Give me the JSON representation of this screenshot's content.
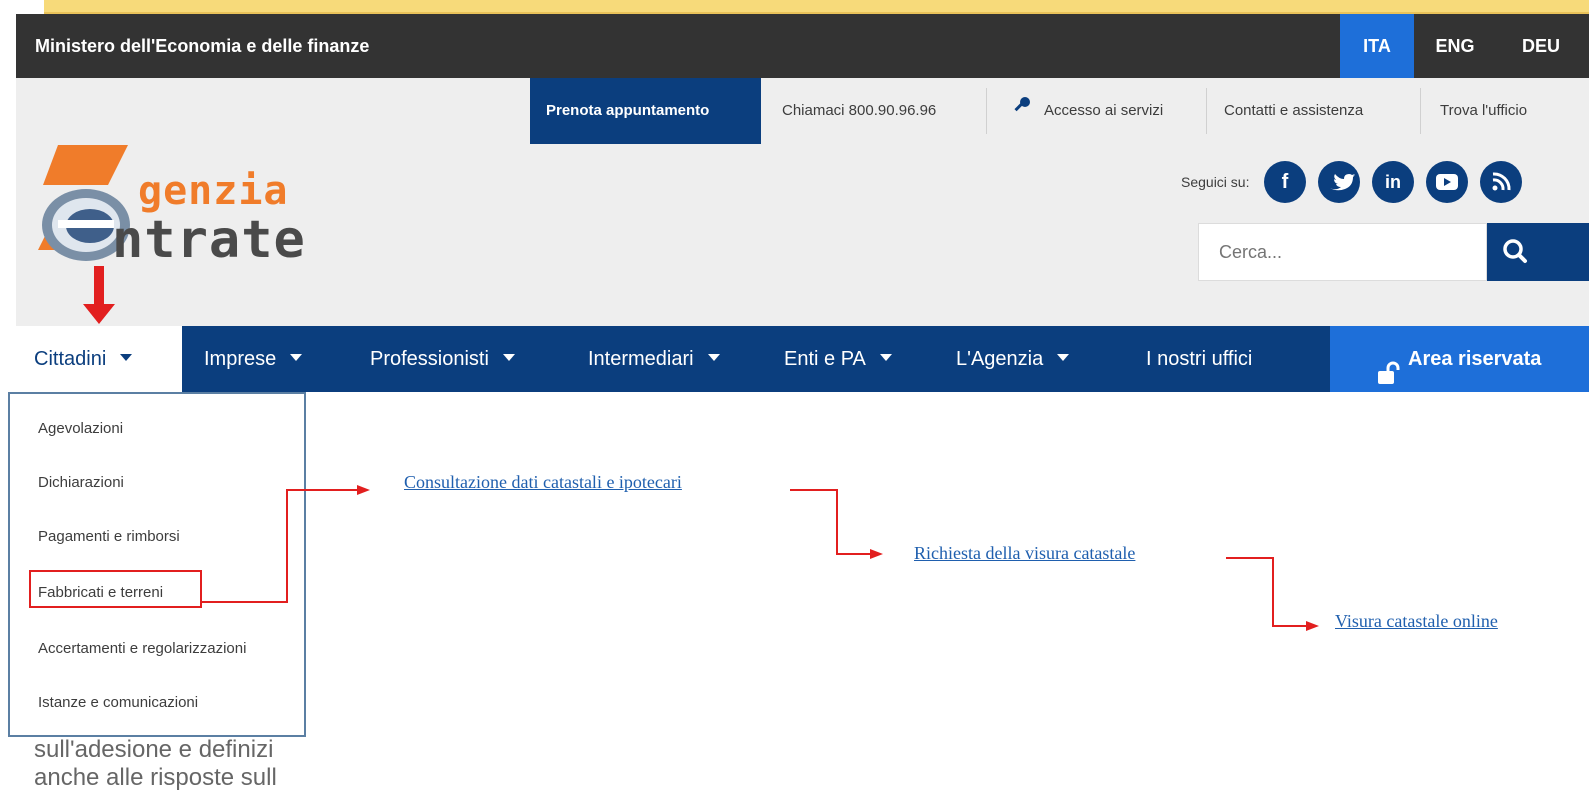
{
  "ministry": {
    "title": "Ministero dell'Economia e delle finanze",
    "languages": [
      "ITA",
      "ENG",
      "DEU"
    ],
    "active_language": "ITA"
  },
  "utility_nav": {
    "prenota": "Prenota appuntamento",
    "chiamaci": "Chiamaci 800.90.96.96",
    "accesso": "Accesso ai servizi",
    "contatti": "Contatti e assistenza",
    "trova": "Trova l'ufficio"
  },
  "logo": {
    "line1": "genzia",
    "line2": "ntrate"
  },
  "social": {
    "label": "Seguici su:",
    "icons": [
      "facebook-icon",
      "twitter-icon",
      "linkedin-icon",
      "youtube-icon",
      "rss-icon"
    ]
  },
  "search": {
    "placeholder": "Cerca..."
  },
  "main_nav": {
    "items": [
      "Cittadini",
      "Imprese",
      "Professionisti",
      "Intermediari",
      "Enti e PA",
      "L'Agenzia",
      "I nostri uffici"
    ],
    "active": "Cittadini",
    "area_riservata": "Area riservata"
  },
  "dropdown": {
    "items": [
      "Agevolazioni",
      "Dichiarazioni",
      "Pagamenti e rimborsi",
      "Fabbricati e terreni",
      "Accertamenti e regolarizzazioni",
      "Istanze e comunicazioni"
    ],
    "highlighted": "Fabbricati e terreni"
  },
  "path_links": {
    "step1": "Consultazione dati catastali e ipotecari",
    "step2": "Richiesta della visura catastale",
    "step3": "Visura catastale online"
  },
  "background_text": {
    "line1": "sull'adesione e definizi",
    "line2": "anche alle risposte sull"
  },
  "colors": {
    "brand_blue": "#0b3e7e",
    "accent_blue": "#1e6fd9",
    "annotation_red": "#e21f1f",
    "logo_orange": "#f07c2a"
  }
}
